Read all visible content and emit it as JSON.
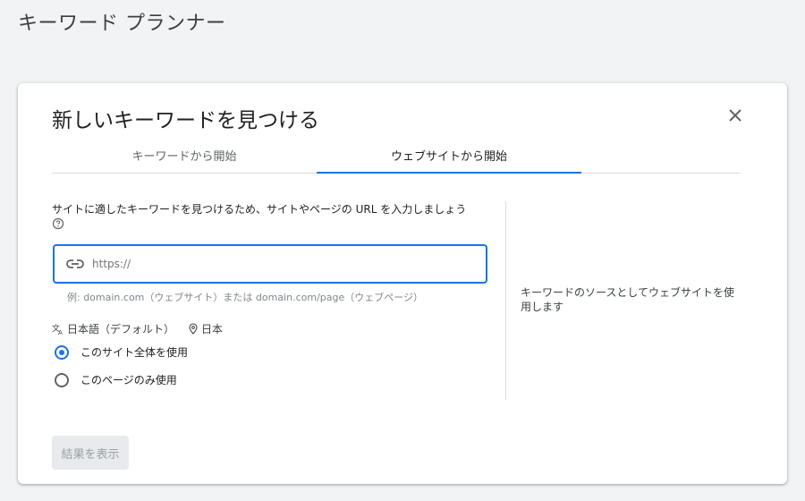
{
  "page": {
    "title": "キーワード プランナー"
  },
  "dialog": {
    "title": "新しいキーワードを見つける",
    "close_icon": "close-icon",
    "tabs": [
      {
        "label": "キーワードから開始",
        "active": false
      },
      {
        "label": "ウェブサイトから開始",
        "active": true
      }
    ],
    "instruction": "サイトに適したキーワードを見つけるため、サイトやページの URL を入力しましょう",
    "help_icon": "help-circle-icon",
    "url_input": {
      "icon": "link-icon",
      "placeholder": "https://",
      "value": ""
    },
    "example_text": "例: domain.com（ウェブサイト）または domain.com/page（ウェブページ）",
    "language": {
      "icon": "translate-icon",
      "label": "日本語（デフォルト）"
    },
    "location": {
      "icon": "location-pin-icon",
      "label": "日本"
    },
    "radio_options": [
      {
        "label": "このサイト全体を使用",
        "selected": true
      },
      {
        "label": "このページのみ使用",
        "selected": false
      }
    ],
    "side_description": "キーワードのソースとしてウェブサイトを使用します",
    "submit_label": "結果を表示"
  },
  "colors": {
    "accent": "#1a73e8",
    "background": "#f1f3f4",
    "disabled_button_bg": "#e8eaed",
    "disabled_button_text": "#9aa0a6"
  }
}
